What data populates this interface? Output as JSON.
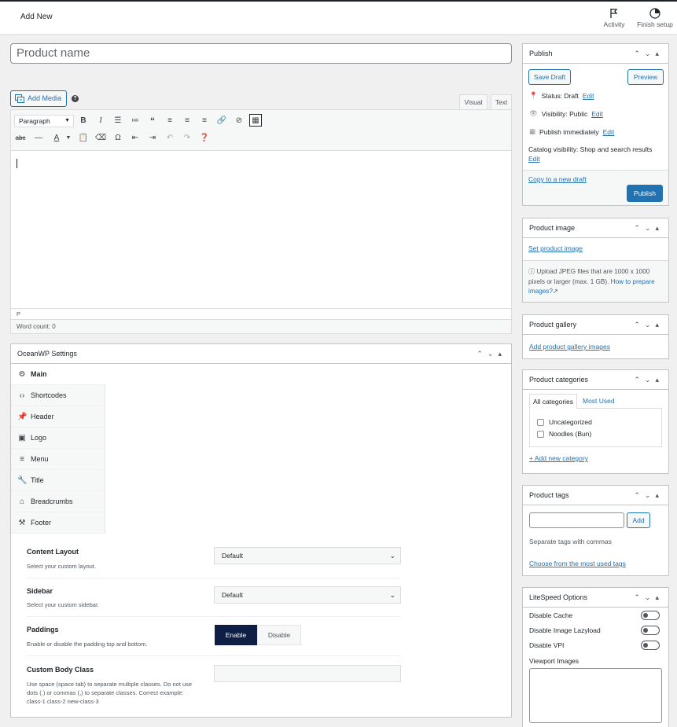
{
  "topbar": {
    "title": "Add New",
    "activity_label": "Activity",
    "finish_label": "Finish setup"
  },
  "product_name": {
    "placeholder": "Product name"
  },
  "editor": {
    "add_media": "Add Media",
    "help": "?",
    "tab_visual": "Visual",
    "tab_text": "Text",
    "format_select": "Paragraph",
    "path": "P",
    "word_count": "Word count: 0"
  },
  "oceanwp": {
    "title": "OceanWP Settings",
    "nav": [
      {
        "label": "Main",
        "icon": "gear-icon"
      },
      {
        "label": "Shortcodes",
        "icon": "code-icon"
      },
      {
        "label": "Header",
        "icon": "pin-icon"
      },
      {
        "label": "Logo",
        "icon": "image-icon"
      },
      {
        "label": "Menu",
        "icon": "menu-icon"
      },
      {
        "label": "Title",
        "icon": "wrench-icon"
      },
      {
        "label": "Breadcrumbs",
        "icon": "home-icon"
      },
      {
        "label": "Footer",
        "icon": "hammer-icon"
      }
    ],
    "content_layout": {
      "label": "Content Layout",
      "desc": "Select your custom layout.",
      "value": "Default"
    },
    "sidebar": {
      "label": "Sidebar",
      "desc": "Select your custom sidebar.",
      "value": "Default"
    },
    "paddings": {
      "label": "Paddings",
      "desc": "Enable or disable the padding top and bottom.",
      "enable": "Enable",
      "disable": "Disable"
    },
    "body_class": {
      "label": "Custom Body Class",
      "desc": "Use space (space tab) to separate multiple classes. Do not use dots (.) or commas (,) to separate classes. Correct example: class-1 class-2 new-class-3"
    }
  },
  "publish": {
    "title": "Publish",
    "save_draft": "Save Draft",
    "preview": "Preview",
    "status_label": "Status: Draft",
    "visibility_label": "Visibility: Public",
    "publish_label": "Publish immediately",
    "edit": "Edit",
    "catalog": "Catalog visibility: Shop and search results",
    "copy_draft": "Copy to a new draft",
    "publish_btn": "Publish"
  },
  "product_image": {
    "title": "Product image",
    "set_link": "Set product image",
    "info_text": "Upload JPEG files that are 1000 x 1000 pixels or larger (max. 1 GB).",
    "how_link": "How to prepare images?"
  },
  "gallery": {
    "title": "Product gallery",
    "add_link": "Add product gallery images"
  },
  "categories": {
    "title": "Product categories",
    "tab_all": "All categories",
    "tab_most": "Most Used",
    "items": [
      "Uncategorized",
      "Noodles (Bun)"
    ],
    "add_link": "+ Add new category"
  },
  "tags": {
    "title": "Product tags",
    "add_btn": "Add",
    "hint": "Separate tags with commas",
    "choose_link": "Choose from the most used tags"
  },
  "litespeed": {
    "title": "LiteSpeed Options",
    "disable_cache": "Disable Cache",
    "disable_lazy": "Disable Image Lazyload",
    "disable_vpi": "Disable VPI",
    "viewport": "Viewport Images"
  },
  "colors": {
    "accent": "#2271b1",
    "dark_btn": "#0f1e45"
  }
}
